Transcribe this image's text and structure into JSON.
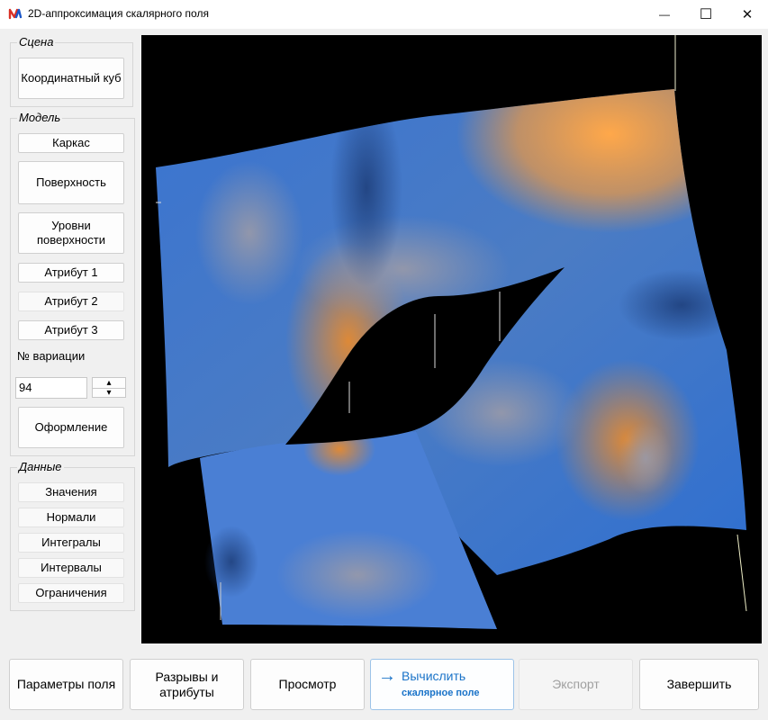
{
  "window": {
    "title": "2D-аппроксимация скалярного поля",
    "min_glyph": "—",
    "max_glyph": "☐",
    "close_glyph": "✕"
  },
  "scene": {
    "legend": "Сцена",
    "coord_cube": "Координатный куб"
  },
  "model": {
    "legend": "Модель",
    "frame": "Каркас",
    "surface": "Поверхность",
    "surface_levels": "Уровни поверхности",
    "attr1": "Атрибут 1",
    "attr2": "Атрибут 2",
    "attr3": "Атрибут 3",
    "variation_label": "№ вариации",
    "variation_value": "94",
    "spin_up": "▴",
    "spin_down": "▾",
    "design": "Оформление"
  },
  "data_group": {
    "legend": "Данные",
    "values": "Значения",
    "normals": "Нормали",
    "integrals": "Интегралы",
    "intervals": "Интервалы",
    "constraints": "Ограничения"
  },
  "bottom": {
    "field_params": "Параметры поля",
    "breaks_attrs": "Разрывы и атрибуты",
    "view": "Просмотр",
    "compute_arrow": "→",
    "compute": "Вычислить",
    "compute_sub": "скалярное поле",
    "export": "Экспорт",
    "finish": "Завершить"
  },
  "colors": {
    "surface_blue": "#2f6fd0",
    "surface_orange": "#f5a040",
    "accent": "#1a73c8",
    "disabled_text": "#a0a0a0"
  },
  "icons": {
    "app": "app-logo-icon",
    "minimize": "minimize-icon",
    "maximize": "maximize-icon",
    "close": "close-icon",
    "arrow": "arrow-right-icon"
  }
}
